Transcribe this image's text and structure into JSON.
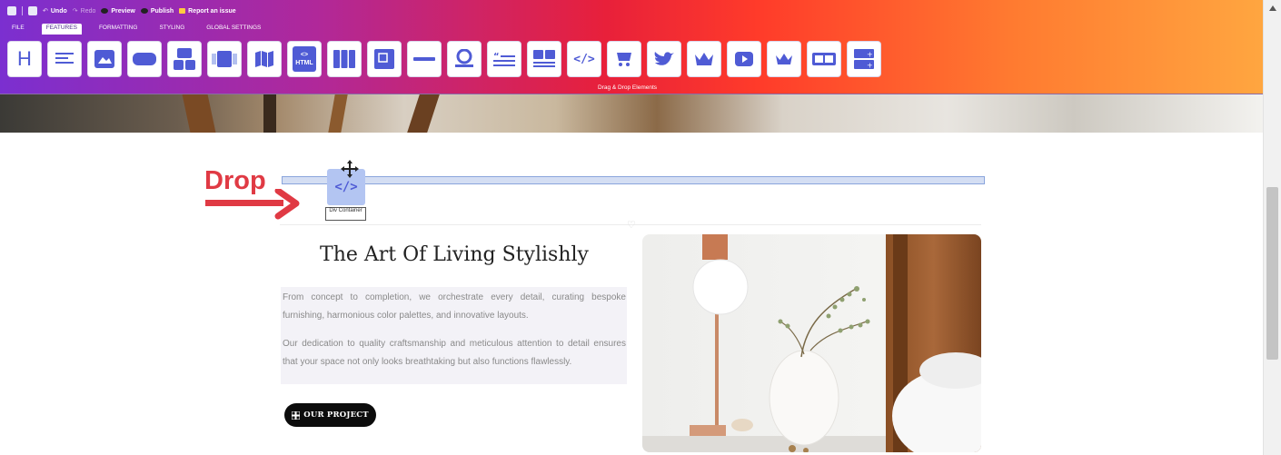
{
  "toolbar": {
    "menu": {
      "undo": "Undo",
      "redo": "Redo",
      "preview": "Preview",
      "publish": "Publish",
      "report": "Report an issue"
    },
    "tabs": [
      {
        "label": "FILE",
        "active": false
      },
      {
        "label": "FEATURES",
        "active": true
      },
      {
        "label": "FORMATTING",
        "active": false
      },
      {
        "label": "STYLING",
        "active": false
      },
      {
        "label": "GLOBAL SETTINGS",
        "active": false
      }
    ],
    "elements_hint": "Drag & Drop Elements",
    "element_icons": [
      "heading-icon",
      "paragraph-icon",
      "image-icon",
      "button-icon",
      "gallery-icon",
      "slider-icon",
      "map-icon",
      "html-icon",
      "columns-icon",
      "box-icon",
      "divider-icon",
      "avatar-icon",
      "quote-icon",
      "image-text-icon",
      "code-icon",
      "cart-icon",
      "twitter-icon",
      "crown-icon",
      "youtube-icon",
      "crown-small-icon",
      "pill-icon",
      "plus-box-icon"
    ],
    "html_label": "HTML"
  },
  "drag": {
    "annotation": "Drop",
    "ghost_glyph": "</>",
    "ghost_label": "Div Container"
  },
  "content": {
    "title": "The Art Of Living Stylishly",
    "paragraph1": "From concept to completion, we orchestrate every detail, curating bespoke furnishing, harmonious color palettes, and innovative layouts.",
    "paragraph2": "Our dedication to quality craftsmanship and meticulous attention to detail ensures that your space not only looks breathtaking but also functions flawlessly.",
    "cta_label": "OUR PROJECT",
    "cta_icon": "grid-icon"
  },
  "colors": {
    "toolbar_start": "#7b2fd0",
    "toolbar_mid": "#e8203a",
    "toolbar_end": "#ffa640",
    "accent": "#4f5bd5",
    "drop_annotation": "#e03a44"
  }
}
